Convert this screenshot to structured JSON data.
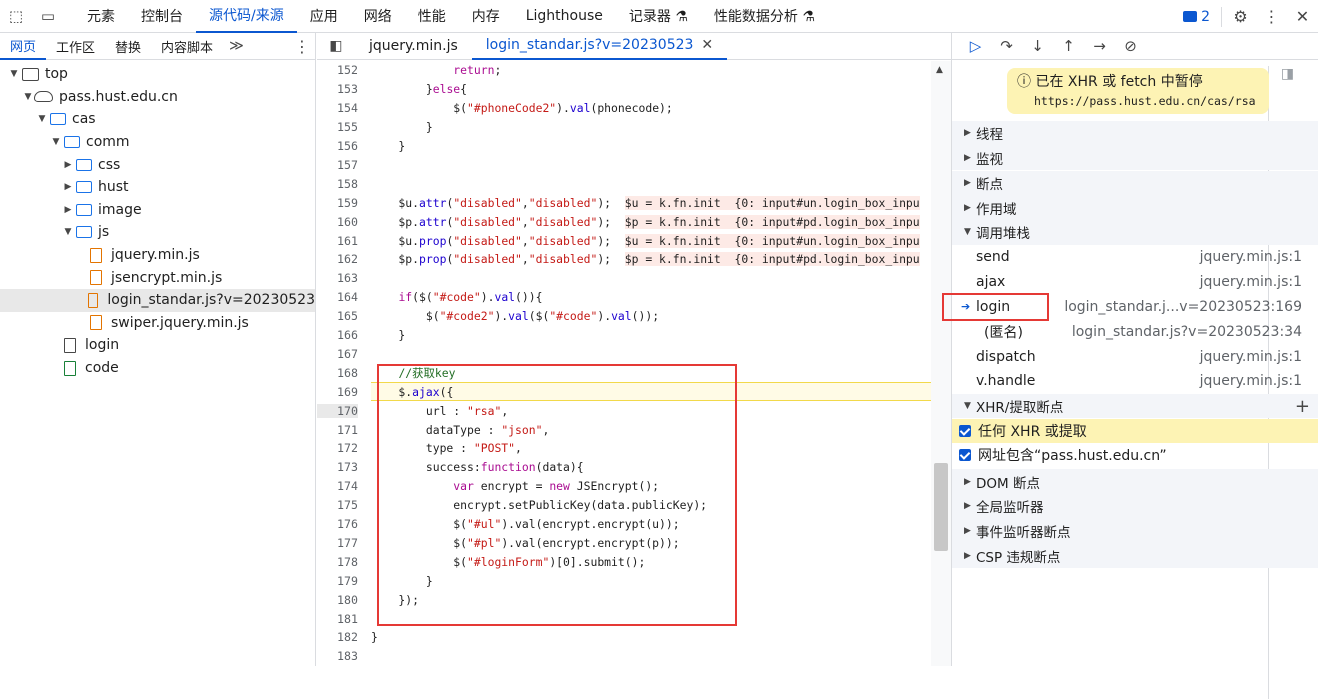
{
  "toolbar": {
    "tabs": [
      "元素",
      "控制台",
      "源代码/来源",
      "应用",
      "网络",
      "性能",
      "内存",
      "Lighthouse",
      "记录器 ⚗",
      "性能数据分析 ⚗"
    ],
    "active_tab": "源代码/来源",
    "issues_count": "2"
  },
  "navigator": {
    "tabs": [
      "网页",
      "工作区",
      "替换",
      "内容脚本"
    ],
    "more": "≫",
    "tree": [
      {
        "label": "top",
        "depth": 0,
        "type": "frame",
        "expanded": true
      },
      {
        "label": "pass.hust.edu.cn",
        "depth": 1,
        "type": "cloud",
        "expanded": true
      },
      {
        "label": "cas",
        "depth": 2,
        "type": "folder",
        "expanded": true
      },
      {
        "label": "comm",
        "depth": 3,
        "type": "folder",
        "expanded": true
      },
      {
        "label": "css",
        "depth": 4,
        "type": "folder",
        "expanded": false
      },
      {
        "label": "hust",
        "depth": 4,
        "type": "folder",
        "expanded": false
      },
      {
        "label": "image",
        "depth": 4,
        "type": "folder",
        "expanded": false
      },
      {
        "label": "js",
        "depth": 4,
        "type": "folder",
        "expanded": true
      },
      {
        "label": "jquery.min.js",
        "depth": 5,
        "type": "js"
      },
      {
        "label": "jsencrypt.min.js",
        "depth": 5,
        "type": "js"
      },
      {
        "label": "login_standar.js?v=20230523",
        "depth": 5,
        "type": "js",
        "selected": true
      },
      {
        "label": "swiper.jquery.min.js",
        "depth": 5,
        "type": "js"
      },
      {
        "label": "login",
        "depth": 3,
        "type": "doc"
      },
      {
        "label": "code",
        "depth": 3,
        "type": "green"
      }
    ]
  },
  "editor": {
    "tabs": [
      {
        "label": "jquery.min.js",
        "active": false
      },
      {
        "label": "login_standar.js?v=20230523",
        "active": true
      }
    ],
    "lines": [
      {
        "n": "152",
        "html": "            <span class=\"kw\">return</span>;"
      },
      {
        "n": "153",
        "html": "        }<span class=\"kw\">else</span>{"
      },
      {
        "n": "154",
        "html": "            $(<span class=\"str\">\"#phoneCode2\"</span>).<span class=\"fn\">val</span>(phonecode);"
      },
      {
        "n": "155",
        "html": "        }"
      },
      {
        "n": "156",
        "html": "    }"
      },
      {
        "n": "157",
        "html": ""
      },
      {
        "n": "158",
        "html": ""
      },
      {
        "n": "159",
        "html": "    $u.<span class=\"fn\">attr</span>(<span class=\"str\">\"disabled\"</span>,<span class=\"str\">\"disabled\"</span>);  <span class=\"annot\">$u = k.fn.init  {0: input#un.login_box_inpu</span>"
      },
      {
        "n": "160",
        "html": "    $p.<span class=\"fn\">attr</span>(<span class=\"str\">\"disabled\"</span>,<span class=\"str\">\"disabled\"</span>);  <span class=\"annot\">$p = k.fn.init  {0: input#pd.login_box_inpu</span>"
      },
      {
        "n": "161",
        "html": "    $u.<span class=\"fn\">prop</span>(<span class=\"str\">\"disabled\"</span>,<span class=\"str\">\"disabled\"</span>);  <span class=\"annot\">$u = k.fn.init  {0: input#un.login_box_inpu</span>"
      },
      {
        "n": "162",
        "html": "    $p.<span class=\"fn\">prop</span>(<span class=\"str\">\"disabled\"</span>,<span class=\"str\">\"disabled\"</span>);  <span class=\"annot\">$p = k.fn.init  {0: input#pd.login_box_inpu</span>"
      },
      {
        "n": "163",
        "html": ""
      },
      {
        "n": "164",
        "html": "    <span class=\"kw\">if</span>($(<span class=\"str\">\"#code\"</span>).<span class=\"fn\">val</span>()){"
      },
      {
        "n": "165",
        "html": "        $(<span class=\"str\">\"#code2\"</span>).<span class=\"fn\">val</span>($(<span class=\"str\">\"#code\"</span>).<span class=\"fn\">val</span>());"
      },
      {
        "n": "166",
        "html": "    }"
      },
      {
        "n": "167",
        "html": ""
      },
      {
        "n": "168",
        "html": "    <span class=\"cm\">//获取key</span>"
      },
      {
        "n": "169",
        "html": "    $.<span class=\"fn\">ajax</span>({",
        "paused": true
      },
      {
        "n": "170",
        "html": "        url : <span class=\"str\">\"rsa\"</span>,",
        "current": true
      },
      {
        "n": "171",
        "html": "        dataType : <span class=\"str\">\"json\"</span>,"
      },
      {
        "n": "172",
        "html": "        type : <span class=\"str\">\"POST\"</span>,"
      },
      {
        "n": "173",
        "html": "        success:<span class=\"kw\">function</span>(data){"
      },
      {
        "n": "174",
        "html": "            <span class=\"kw\">var</span> encrypt = <span class=\"kw\">new</span> JSEncrypt();"
      },
      {
        "n": "175",
        "html": "            encrypt.setPublicKey(data.publicKey);"
      },
      {
        "n": "176",
        "html": "            $(<span class=\"str\">\"#ul\"</span>).val(encrypt.encrypt(u));"
      },
      {
        "n": "177",
        "html": "            $(<span class=\"str\">\"#pl\"</span>).val(encrypt.encrypt(p));"
      },
      {
        "n": "178",
        "html": "            $(<span class=\"str\">\"#loginForm\"</span>)[0].submit();"
      },
      {
        "n": "179",
        "html": "        }"
      },
      {
        "n": "180",
        "html": "    });"
      },
      {
        "n": "181",
        "html": ""
      },
      {
        "n": "182",
        "html": "}"
      },
      {
        "n": "183",
        "html": ""
      }
    ]
  },
  "debugger": {
    "paused_title": "已在 XHR 或 fetch 中暂停",
    "paused_url": "https://pass.hust.edu.cn/cas/rsa",
    "sections_top": [
      "线程",
      "监视",
      "断点",
      "作用域"
    ],
    "callstack_title": "调用堆栈",
    "callstack": [
      {
        "name": "send",
        "loc": "jquery.min.js:1"
      },
      {
        "name": "ajax",
        "loc": "jquery.min.js:1"
      },
      {
        "name": "login",
        "loc": "login_standar.j...v=20230523:169",
        "current": true
      },
      {
        "name": "(匿名)",
        "loc": "login_standar.js?v=20230523:34"
      },
      {
        "name": "dispatch",
        "loc": "jquery.min.js:1"
      },
      {
        "name": "v.handle",
        "loc": "jquery.min.js:1"
      }
    ],
    "xhr_title": "XHR/提取断点",
    "xhr_items": [
      {
        "label": "任何 XHR 或提取",
        "highlighted": true
      },
      {
        "label": "网址包含“pass.hust.edu.cn”",
        "highlighted": false
      }
    ],
    "sections_bottom": [
      "DOM 断点",
      "全局监听器",
      "事件监听器断点",
      "CSP 违规断点"
    ]
  }
}
